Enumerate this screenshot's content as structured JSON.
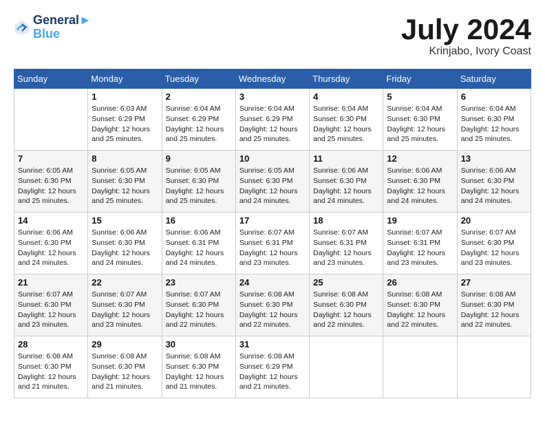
{
  "header": {
    "logo_line1": "General",
    "logo_line2": "Blue",
    "month_title": "July 2024",
    "location": "Krinjabo, Ivory Coast"
  },
  "weekdays": [
    "Sunday",
    "Monday",
    "Tuesday",
    "Wednesday",
    "Thursday",
    "Friday",
    "Saturday"
  ],
  "weeks": [
    [
      {
        "day": "",
        "sunrise": "",
        "sunset": "",
        "daylight": ""
      },
      {
        "day": "1",
        "sunrise": "Sunrise: 6:03 AM",
        "sunset": "Sunset: 6:29 PM",
        "daylight": "Daylight: 12 hours and 25 minutes."
      },
      {
        "day": "2",
        "sunrise": "Sunrise: 6:04 AM",
        "sunset": "Sunset: 6:29 PM",
        "daylight": "Daylight: 12 hours and 25 minutes."
      },
      {
        "day": "3",
        "sunrise": "Sunrise: 6:04 AM",
        "sunset": "Sunset: 6:29 PM",
        "daylight": "Daylight: 12 hours and 25 minutes."
      },
      {
        "day": "4",
        "sunrise": "Sunrise: 6:04 AM",
        "sunset": "Sunset: 6:30 PM",
        "daylight": "Daylight: 12 hours and 25 minutes."
      },
      {
        "day": "5",
        "sunrise": "Sunrise: 6:04 AM",
        "sunset": "Sunset: 6:30 PM",
        "daylight": "Daylight: 12 hours and 25 minutes."
      },
      {
        "day": "6",
        "sunrise": "Sunrise: 6:04 AM",
        "sunset": "Sunset: 6:30 PM",
        "daylight": "Daylight: 12 hours and 25 minutes."
      }
    ],
    [
      {
        "day": "7",
        "sunrise": "Sunrise: 6:05 AM",
        "sunset": "Sunset: 6:30 PM",
        "daylight": "Daylight: 12 hours and 25 minutes."
      },
      {
        "day": "8",
        "sunrise": "Sunrise: 6:05 AM",
        "sunset": "Sunset: 6:30 PM",
        "daylight": "Daylight: 12 hours and 25 minutes."
      },
      {
        "day": "9",
        "sunrise": "Sunrise: 6:05 AM",
        "sunset": "Sunset: 6:30 PM",
        "daylight": "Daylight: 12 hours and 25 minutes."
      },
      {
        "day": "10",
        "sunrise": "Sunrise: 6:05 AM",
        "sunset": "Sunset: 6:30 PM",
        "daylight": "Daylight: 12 hours and 24 minutes."
      },
      {
        "day": "11",
        "sunrise": "Sunrise: 6:06 AM",
        "sunset": "Sunset: 6:30 PM",
        "daylight": "Daylight: 12 hours and 24 minutes."
      },
      {
        "day": "12",
        "sunrise": "Sunrise: 6:06 AM",
        "sunset": "Sunset: 6:30 PM",
        "daylight": "Daylight: 12 hours and 24 minutes."
      },
      {
        "day": "13",
        "sunrise": "Sunrise: 6:06 AM",
        "sunset": "Sunset: 6:30 PM",
        "daylight": "Daylight: 12 hours and 24 minutes."
      }
    ],
    [
      {
        "day": "14",
        "sunrise": "Sunrise: 6:06 AM",
        "sunset": "Sunset: 6:30 PM",
        "daylight": "Daylight: 12 hours and 24 minutes."
      },
      {
        "day": "15",
        "sunrise": "Sunrise: 6:06 AM",
        "sunset": "Sunset: 6:30 PM",
        "daylight": "Daylight: 12 hours and 24 minutes."
      },
      {
        "day": "16",
        "sunrise": "Sunrise: 6:06 AM",
        "sunset": "Sunset: 6:31 PM",
        "daylight": "Daylight: 12 hours and 24 minutes."
      },
      {
        "day": "17",
        "sunrise": "Sunrise: 6:07 AM",
        "sunset": "Sunset: 6:31 PM",
        "daylight": "Daylight: 12 hours and 23 minutes."
      },
      {
        "day": "18",
        "sunrise": "Sunrise: 6:07 AM",
        "sunset": "Sunset: 6:31 PM",
        "daylight": "Daylight: 12 hours and 23 minutes."
      },
      {
        "day": "19",
        "sunrise": "Sunrise: 6:07 AM",
        "sunset": "Sunset: 6:31 PM",
        "daylight": "Daylight: 12 hours and 23 minutes."
      },
      {
        "day": "20",
        "sunrise": "Sunrise: 6:07 AM",
        "sunset": "Sunset: 6:30 PM",
        "daylight": "Daylight: 12 hours and 23 minutes."
      }
    ],
    [
      {
        "day": "21",
        "sunrise": "Sunrise: 6:07 AM",
        "sunset": "Sunset: 6:30 PM",
        "daylight": "Daylight: 12 hours and 23 minutes."
      },
      {
        "day": "22",
        "sunrise": "Sunrise: 6:07 AM",
        "sunset": "Sunset: 6:30 PM",
        "daylight": "Daylight: 12 hours and 23 minutes."
      },
      {
        "day": "23",
        "sunrise": "Sunrise: 6:07 AM",
        "sunset": "Sunset: 6:30 PM",
        "daylight": "Daylight: 12 hours and 22 minutes."
      },
      {
        "day": "24",
        "sunrise": "Sunrise: 6:08 AM",
        "sunset": "Sunset: 6:30 PM",
        "daylight": "Daylight: 12 hours and 22 minutes."
      },
      {
        "day": "25",
        "sunrise": "Sunrise: 6:08 AM",
        "sunset": "Sunset: 6:30 PM",
        "daylight": "Daylight: 12 hours and 22 minutes."
      },
      {
        "day": "26",
        "sunrise": "Sunrise: 6:08 AM",
        "sunset": "Sunset: 6:30 PM",
        "daylight": "Daylight: 12 hours and 22 minutes."
      },
      {
        "day": "27",
        "sunrise": "Sunrise: 6:08 AM",
        "sunset": "Sunset: 6:30 PM",
        "daylight": "Daylight: 12 hours and 22 minutes."
      }
    ],
    [
      {
        "day": "28",
        "sunrise": "Sunrise: 6:08 AM",
        "sunset": "Sunset: 6:30 PM",
        "daylight": "Daylight: 12 hours and 21 minutes."
      },
      {
        "day": "29",
        "sunrise": "Sunrise: 6:08 AM",
        "sunset": "Sunset: 6:30 PM",
        "daylight": "Daylight: 12 hours and 21 minutes."
      },
      {
        "day": "30",
        "sunrise": "Sunrise: 6:08 AM",
        "sunset": "Sunset: 6:30 PM",
        "daylight": "Daylight: 12 hours and 21 minutes."
      },
      {
        "day": "31",
        "sunrise": "Sunrise: 6:08 AM",
        "sunset": "Sunset: 6:29 PM",
        "daylight": "Daylight: 12 hours and 21 minutes."
      },
      {
        "day": "",
        "sunrise": "",
        "sunset": "",
        "daylight": ""
      },
      {
        "day": "",
        "sunrise": "",
        "sunset": "",
        "daylight": ""
      },
      {
        "day": "",
        "sunrise": "",
        "sunset": "",
        "daylight": ""
      }
    ]
  ]
}
